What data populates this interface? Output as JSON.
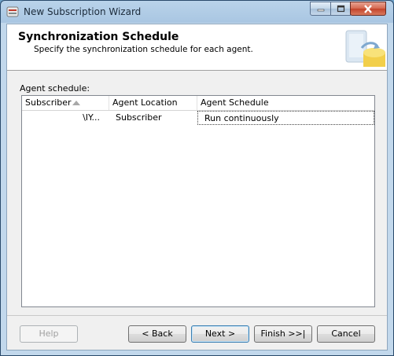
{
  "window": {
    "title": "New Subscription Wizard"
  },
  "header": {
    "title": "Synchronization Schedule",
    "subtitle": "Specify the synchronization schedule for each agent."
  },
  "grid": {
    "label": "Agent schedule:",
    "columns": [
      "Subscriber",
      "Agent Location",
      "Agent Schedule"
    ],
    "rows": [
      {
        "subscriber": "\\IY...",
        "agent_location": "Subscriber",
        "agent_schedule": "Run continuously"
      }
    ]
  },
  "buttons": {
    "help": "Help",
    "back": "< Back",
    "next": "Next >",
    "finish": "Finish >>|",
    "cancel": "Cancel"
  },
  "icons": {
    "app": "sql-server-app-icon",
    "header": "database-sync-icon",
    "sort": "sort-ascending-icon"
  }
}
